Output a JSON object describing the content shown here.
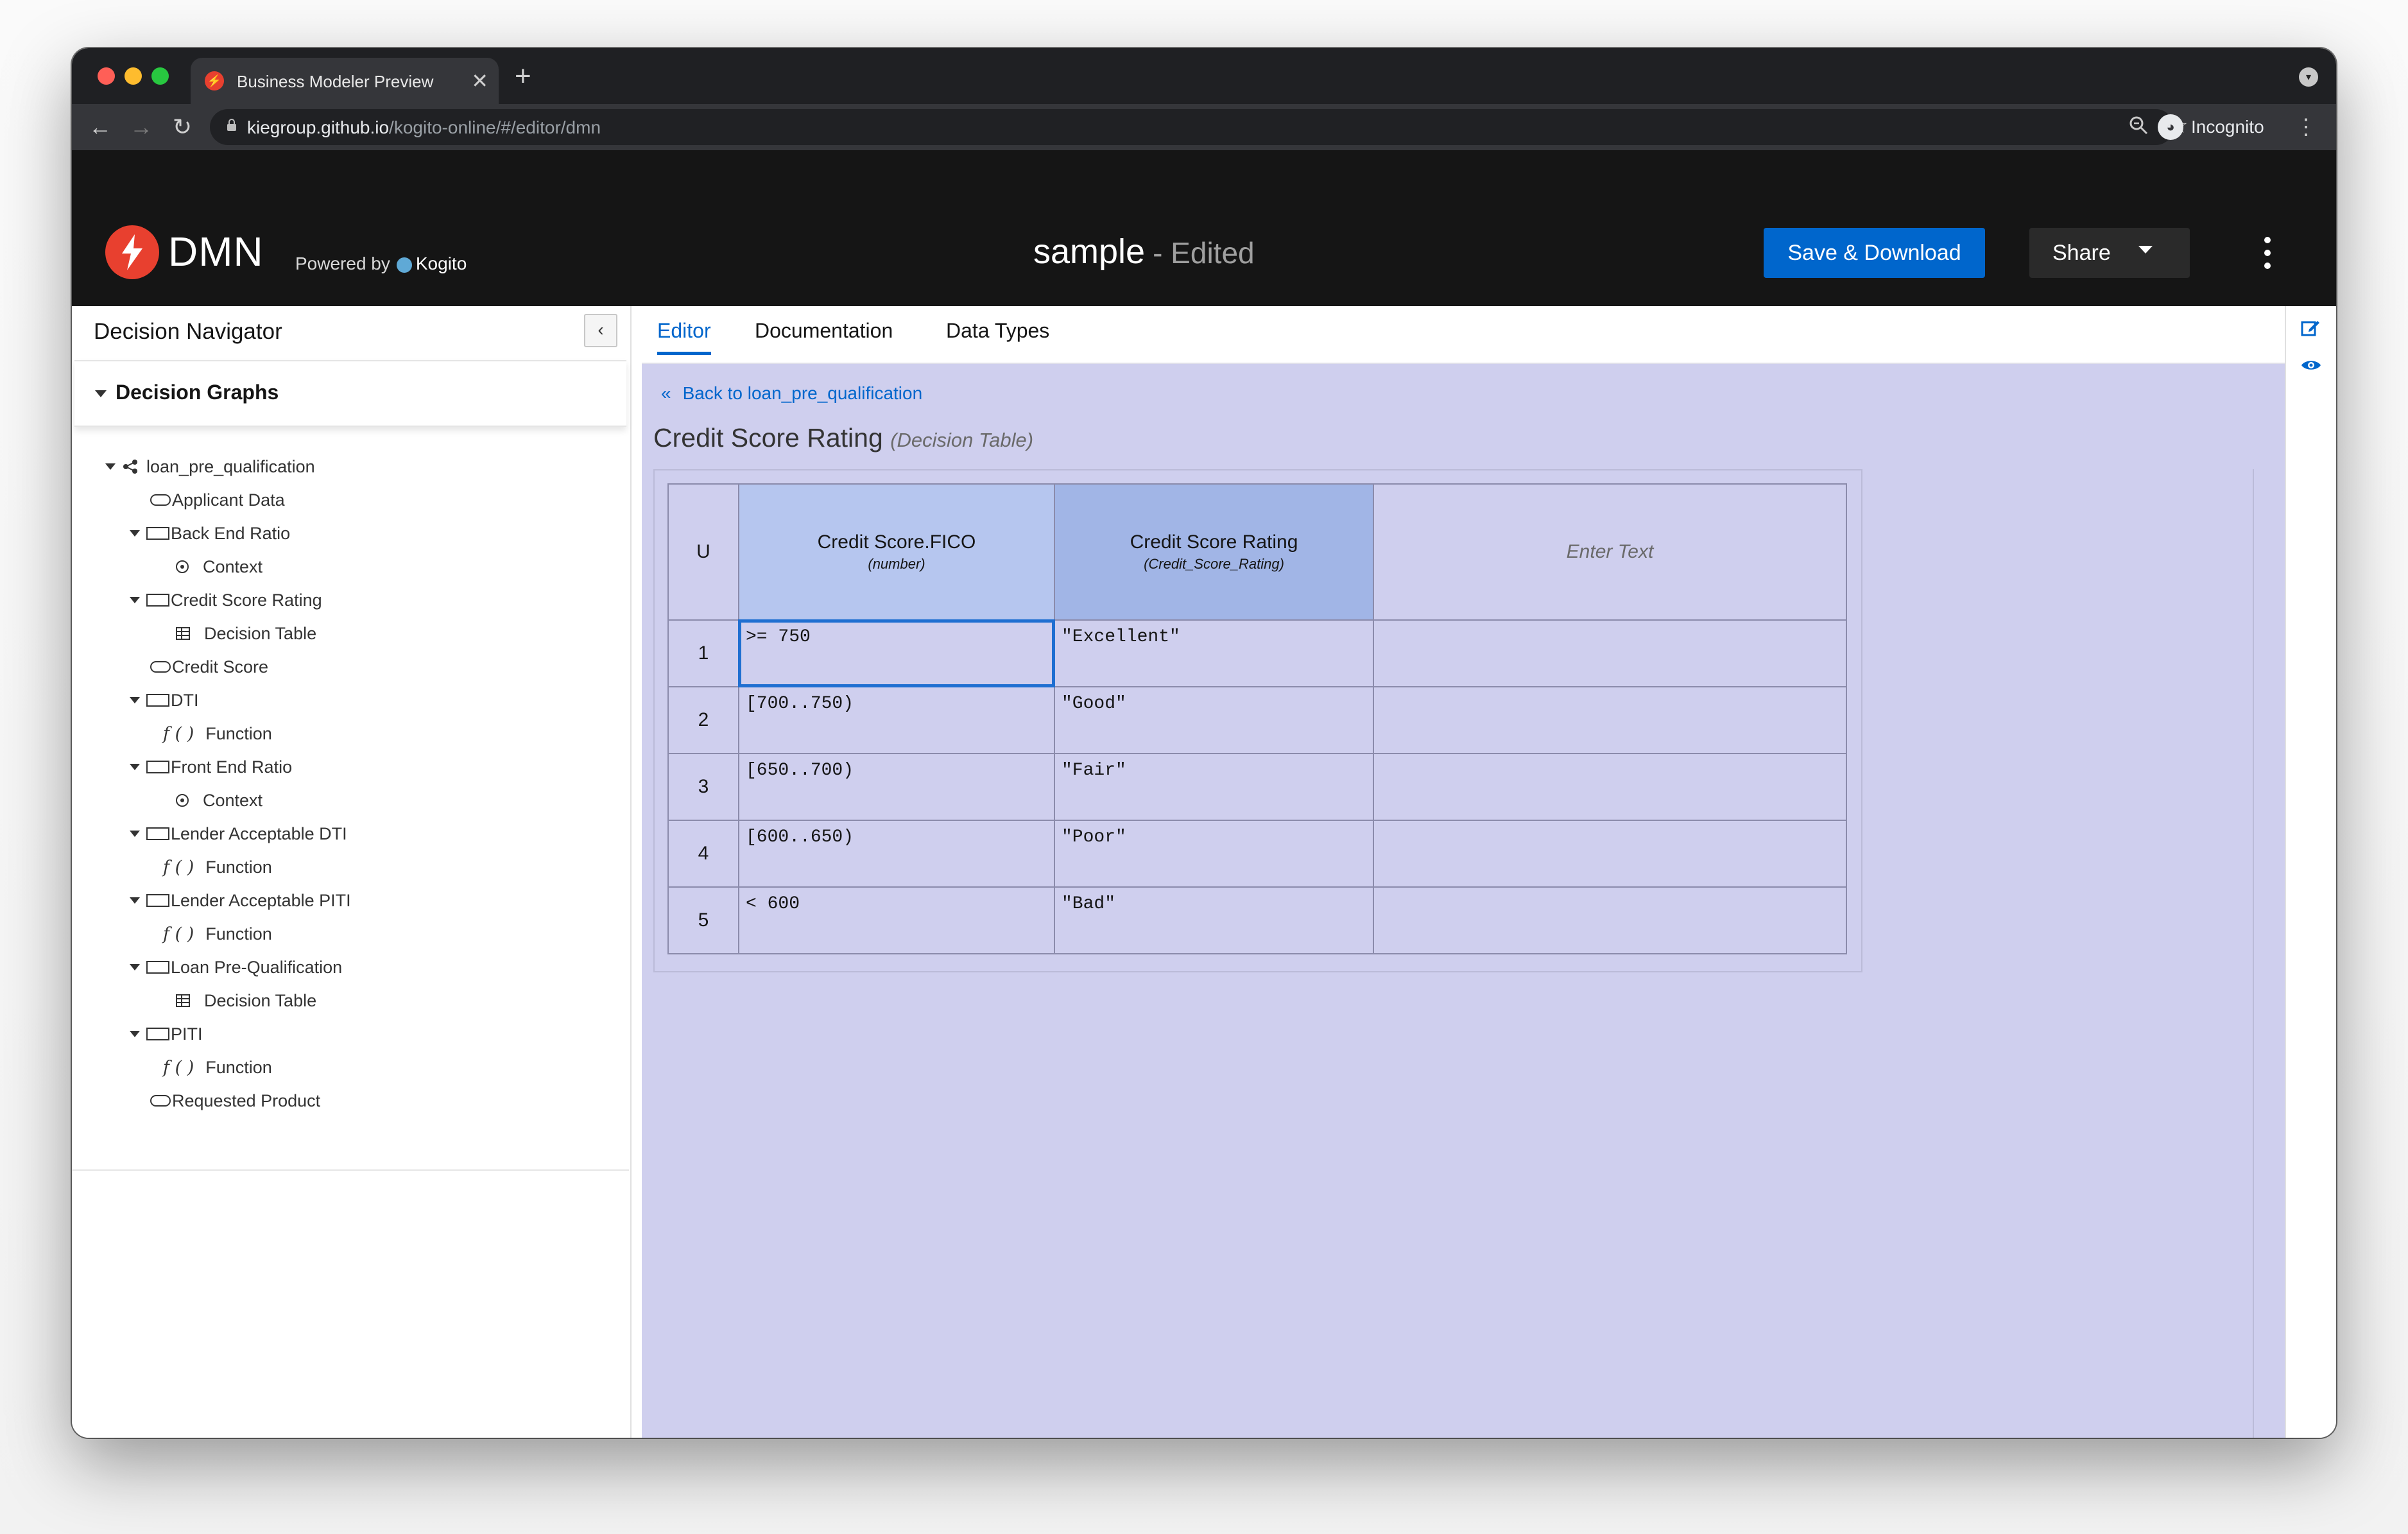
{
  "browser": {
    "tab_title": "Business Modeler Preview",
    "url_host": "kiegroup.github.io",
    "url_path": "/kogito-online/#/editor/dmn",
    "profile": "Incognito"
  },
  "header": {
    "app_name": "DMN",
    "powered_by": "Powered by",
    "powered_name": "Kogito",
    "doc_name": "sample",
    "doc_status": "- Edited",
    "save_label": "Save & Download",
    "share_label": "Share"
  },
  "navigator": {
    "title": "Decision Navigator",
    "section": "Decision Graphs",
    "items": [
      {
        "label": "loan_pre_qualification",
        "icon": "graph-icon"
      },
      {
        "label": "Applicant Data",
        "icon": "input-data-icon"
      },
      {
        "label": "Back End Ratio",
        "icon": "decision-icon"
      },
      {
        "label": "Context",
        "icon": "context-icon"
      },
      {
        "label": "Credit Score Rating",
        "icon": "decision-icon"
      },
      {
        "label": "Decision Table",
        "icon": "decision-table-icon"
      },
      {
        "label": "Credit Score",
        "icon": "input-data-icon"
      },
      {
        "label": "DTI",
        "icon": "decision-icon"
      },
      {
        "label": "Function",
        "icon": "function-icon"
      },
      {
        "label": "Front End Ratio",
        "icon": "decision-icon"
      },
      {
        "label": "Context",
        "icon": "context-icon"
      },
      {
        "label": "Lender Acceptable DTI",
        "icon": "decision-icon"
      },
      {
        "label": "Function",
        "icon": "function-icon"
      },
      {
        "label": "Lender Acceptable PITI",
        "icon": "decision-icon"
      },
      {
        "label": "Function",
        "icon": "function-icon"
      },
      {
        "label": "Loan Pre-Qualification",
        "icon": "decision-icon"
      },
      {
        "label": "Decision Table",
        "icon": "decision-table-icon"
      },
      {
        "label": "PITI",
        "icon": "decision-icon"
      },
      {
        "label": "Function",
        "icon": "function-icon"
      },
      {
        "label": "Requested Product",
        "icon": "input-data-icon"
      }
    ],
    "function_glyph": "f ( )"
  },
  "editor": {
    "tabs": [
      "Editor",
      "Documentation",
      "Data Types"
    ],
    "active_tab": "Editor",
    "back_link": "Back to loan_pre_qualification",
    "expression_name": "Credit Score Rating",
    "expression_kind": "(Decision Table)",
    "table": {
      "hit_policy": "U",
      "input_header": "Credit Score.FICO",
      "input_type": "(number)",
      "output_header": "Credit Score Rating",
      "output_type": "(Credit_Score_Rating)",
      "annotation_header": "Enter Text",
      "rows": [
        {
          "num": "1",
          "input": ">= 750",
          "output": "\"Excellent\"",
          "annotation": ""
        },
        {
          "num": "2",
          "input": "[700..750)",
          "output": "\"Good\"",
          "annotation": ""
        },
        {
          "num": "3",
          "input": "[650..700)",
          "output": "\"Fair\"",
          "annotation": ""
        },
        {
          "num": "4",
          "input": "[600..650)",
          "output": "\"Poor\"",
          "annotation": ""
        },
        {
          "num": "5",
          "input": "< 600",
          "output": "\"Bad\"",
          "annotation": ""
        }
      ]
    }
  },
  "colors": {
    "accent": "#0066cc",
    "header_bg": "#151515",
    "canvas_bg": "#cfcfee",
    "input_header": "#b6c6ef",
    "output_header": "#a1b5e6"
  }
}
